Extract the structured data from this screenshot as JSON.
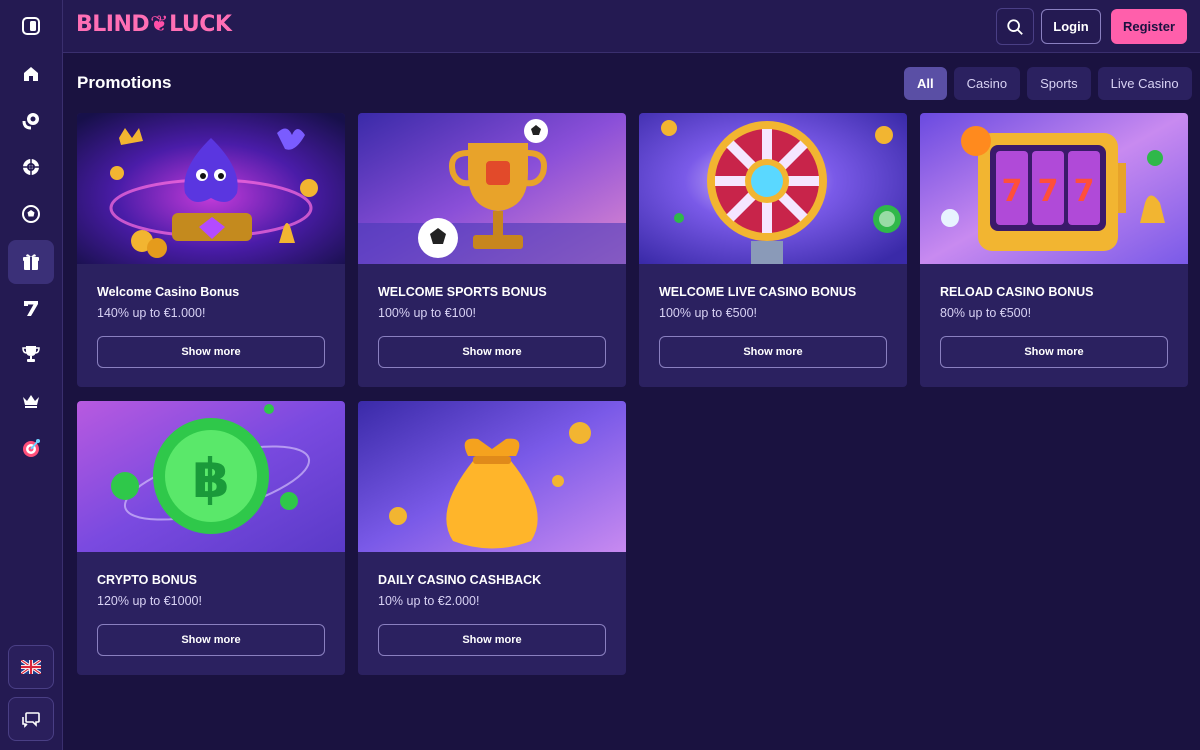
{
  "brand": {
    "logo_left": "BLIND",
    "logo_right": "LUCK"
  },
  "header": {
    "login_label": "Login",
    "register_label": "Register"
  },
  "sidebar": {
    "items": [
      {
        "icon": "collapse-sidebar-icon"
      },
      {
        "icon": "home-icon"
      },
      {
        "icon": "casino-chips-icon"
      },
      {
        "icon": "roulette-icon"
      },
      {
        "icon": "soccer-ball-icon"
      },
      {
        "icon": "gift-icon",
        "active": true
      },
      {
        "icon": "seven-icon"
      },
      {
        "icon": "trophy-icon"
      },
      {
        "icon": "crown-icon"
      },
      {
        "icon": "target-icon"
      }
    ],
    "language_icon": "uk-flag-icon",
    "chat_icon": "chat-icon"
  },
  "main": {
    "title": "Promotions",
    "filters": [
      {
        "label": "All",
        "active": true
      },
      {
        "label": "Casino"
      },
      {
        "label": "Sports"
      },
      {
        "label": "Live Casino"
      }
    ],
    "promos": [
      {
        "title": "Welcome Casino Bonus",
        "subtitle": "140% up to €1.000!",
        "button": "Show more",
        "image": "spade-mascot-slot"
      },
      {
        "title": "WELCOME SPORTS BONUS",
        "subtitle": "100% up to €100!",
        "button": "Show more",
        "image": "golden-trophy-footballs"
      },
      {
        "title": "WELCOME LIVE CASINO BONUS",
        "subtitle": "100% up to €500!",
        "button": "Show more",
        "image": "fortune-wheel"
      },
      {
        "title": "RELOAD CASINO BONUS",
        "subtitle": "80% up to €500!",
        "button": "Show more",
        "image": "slot-machine-777"
      },
      {
        "title": "CRYPTO BONUS",
        "subtitle": "120% up to €1000!",
        "button": "Show more",
        "image": "bitcoin-coin"
      },
      {
        "title": "DAILY CASINO CASHBACK",
        "subtitle": "10% up to €2.000!",
        "button": "Show more",
        "image": "gold-coin-bag"
      }
    ]
  },
  "colors": {
    "accent": "#ff5fab",
    "background": "#1a1240",
    "card": "#2b2160",
    "panel": "#241a52"
  }
}
